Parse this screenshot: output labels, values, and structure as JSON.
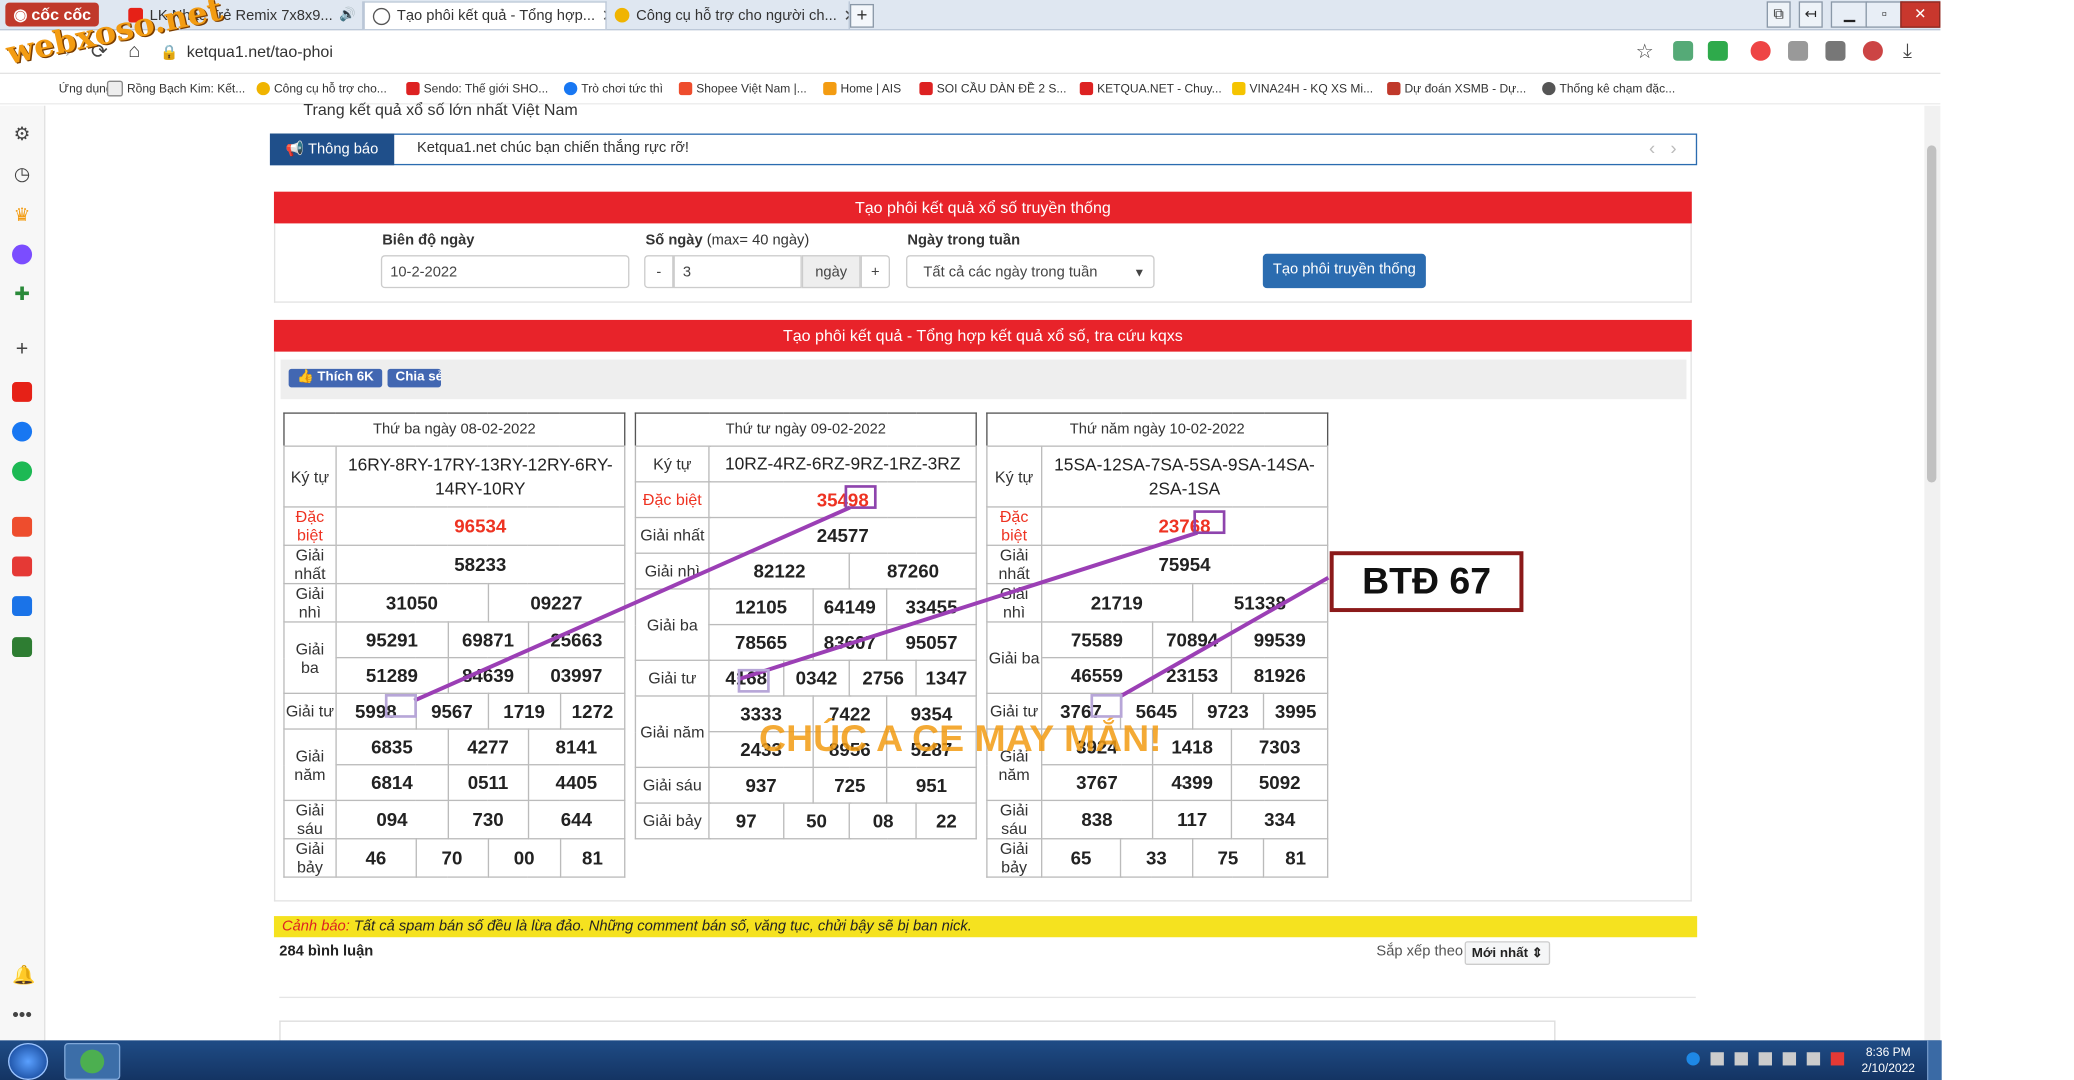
{
  "browser": {
    "brand": "cốc cốc",
    "tabs": [
      {
        "label": "LK Nhạc Trẻ Remix 7x8x9...",
        "active": false
      },
      {
        "label": "Tạo phôi kết quả - Tổng hợp...",
        "active": true
      },
      {
        "label": "Công cụ hỗ trợ cho người ch...",
        "active": false
      }
    ],
    "url": "ketqua1.net/tao-phoi",
    "bookmarks": [
      "Ứng dụng",
      "Rồng Bạch Kim: Kết...",
      "Công cụ hỗ trợ cho...",
      "Sendo: Thế giới SHO...",
      "Trò chơi tức thì",
      "Shopee Việt Nam |...",
      "Home | AIS",
      "SOI CẦU DÀN ĐỀ 2 S...",
      "KETQUA.NET - Chuy...",
      "VINA24H - KQ XS Mi...",
      "Dự đoán XSMB - Dự...",
      "Thống kê chạm đặc..."
    ]
  },
  "watermark": "webxoso.net",
  "site": {
    "tagline": "Trang kết quả xổ số lớn nhất Việt Nam",
    "notice_label": "Thông báo",
    "notice_text": "Ketqua1.net chúc bạn chiến thắng rực rỡ!",
    "section1_title": "Tạo phôi kết quả xổ số truyền thống",
    "form": {
      "range_label": "Biên độ ngày",
      "range_value": "10-2-2022",
      "days_label": "Số ngày",
      "days_hint": "(max= 40 ngày)",
      "minus": "-",
      "days_value": "3",
      "days_unit": "ngày",
      "plus": "+",
      "weekday_label": "Ngày trong tuần",
      "weekday_value": "Tất cả các ngày trong tuần",
      "submit": "Tạo phôi truyền thống"
    },
    "section2_title": "Tạo phôi kết quả - Tổng hợp kết quả xổ số, tra cứu kqxs",
    "like_label": "Thích 6K",
    "share_label": "Chia sẻ",
    "warning_prefix": "Cảnh báo:",
    "warning_text": "Tất cả spam bán số đều là lừa đảo. Những comment bán số, văng tục, chửi bậy sẽ bị ban nick.",
    "comments_count": "284 bình luận",
    "sort_label": "Sắp xếp theo",
    "sort_value": "Mới nhất"
  },
  "labels": {
    "kytu": "Ký tự",
    "db": "Đặc biệt",
    "g1": "Giải nhất",
    "g2": "Giải nhì",
    "g3": "Giải ba",
    "g4": "Giải tư",
    "g5": "Giải năm",
    "g6": "Giải sáu",
    "g7": "Giải bảy"
  },
  "results": [
    {
      "date": "Thứ ba ngày 08-02-2022",
      "kytu": "16RY-8RY-17RY-13RY-12RY-6RY-14RY-10RY",
      "db": "96534",
      "g1": "58233",
      "g2": [
        "31050",
        "09227"
      ],
      "g3": [
        "95291",
        "69871",
        "25663",
        "51289",
        "84639",
        "03997"
      ],
      "g4": [
        "5998",
        "9567",
        "1719",
        "1272"
      ],
      "g5": [
        "6835",
        "4277",
        "8141",
        "6814",
        "0511",
        "4405"
      ],
      "g6": [
        "094",
        "730",
        "644"
      ],
      "g7": [
        "46",
        "70",
        "00",
        "81"
      ]
    },
    {
      "date": "Thứ tư ngày 09-02-2022",
      "kytu": "10RZ-4RZ-6RZ-9RZ-1RZ-3RZ",
      "db": "35498",
      "g1": "24577",
      "g2": [
        "82122",
        "87260"
      ],
      "g3": [
        "12105",
        "64149",
        "33455",
        "78565",
        "83607",
        "95057"
      ],
      "g4": [
        "4168",
        "0342",
        "2756",
        "1347"
      ],
      "g5": [
        "3333",
        "7422",
        "9354",
        "2433",
        "8956",
        "5287"
      ],
      "g6": [
        "937",
        "725",
        "951"
      ],
      "g7": [
        "97",
        "50",
        "08",
        "22"
      ]
    },
    {
      "date": "Thứ năm ngày 10-02-2022",
      "kytu": "15SA-12SA-7SA-5SA-9SA-14SA-2SA-1SA",
      "db": "23768",
      "g1": "75954",
      "g2": [
        "21719",
        "51338"
      ],
      "g3": [
        "75589",
        "70894",
        "99539",
        "46559",
        "23153",
        "81926"
      ],
      "g4": [
        "3767",
        "5645",
        "9723",
        "3995"
      ],
      "g5": [
        "3924",
        "1418",
        "7303",
        "3767",
        "4399",
        "5092"
      ],
      "g6": [
        "838",
        "117",
        "334"
      ],
      "g7": [
        "65",
        "33",
        "75",
        "81"
      ]
    }
  ],
  "annotation": {
    "box_text": "BTĐ 67",
    "wish_text": "CHÚC A CE MAY MẮN!"
  },
  "taskbar": {
    "time": "8:36 PM",
    "date": "2/10/2022"
  }
}
